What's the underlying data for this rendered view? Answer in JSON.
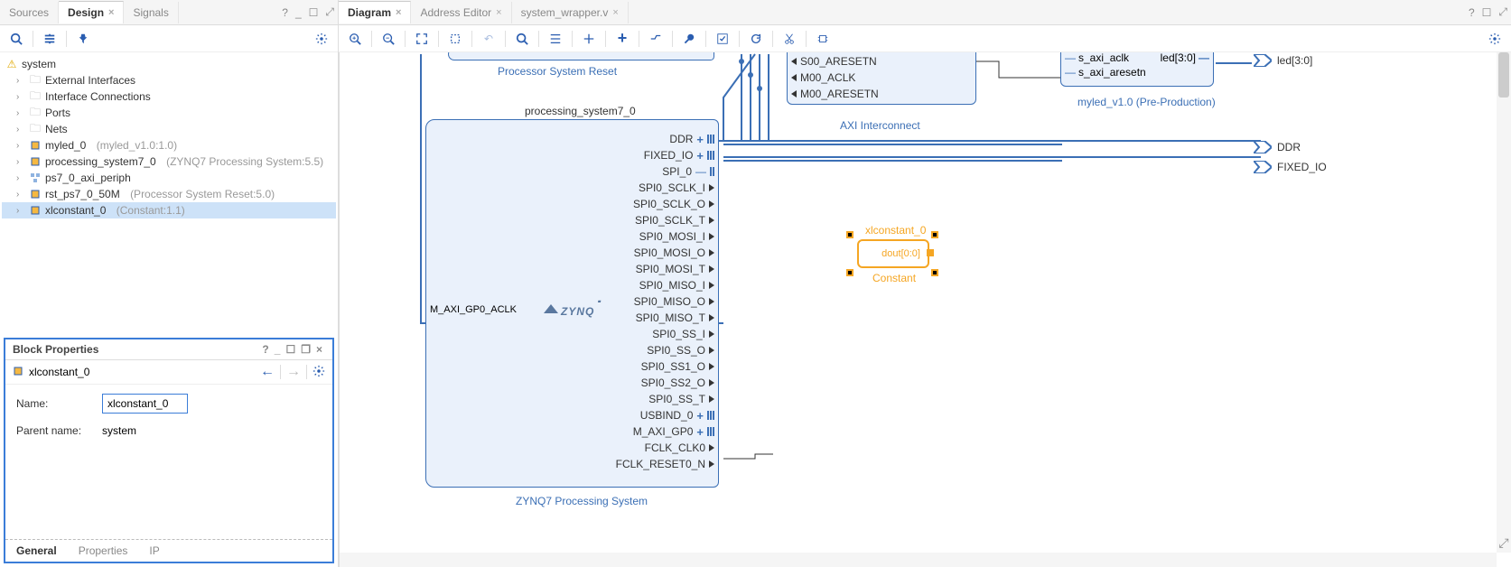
{
  "left_tabs": {
    "sources": "Sources",
    "design": "Design",
    "signals": "Signals"
  },
  "tree": {
    "root": "system",
    "items": [
      {
        "label": "External Interfaces",
        "type": "folder"
      },
      {
        "label": "Interface Connections",
        "type": "folder"
      },
      {
        "label": "Ports",
        "type": "folder"
      },
      {
        "label": "Nets",
        "type": "folder"
      },
      {
        "label": "myled_0",
        "dim": "(myled_v1.0:1.0)",
        "type": "ip"
      },
      {
        "label": "processing_system7_0",
        "dim": "(ZYNQ7 Processing System:5.5)",
        "type": "ip"
      },
      {
        "label": "ps7_0_axi_periph",
        "dim": "",
        "type": "hier"
      },
      {
        "label": "rst_ps7_0_50M",
        "dim": "(Processor System Reset:5.0)",
        "type": "ip"
      },
      {
        "label": "xlconstant_0",
        "dim": "(Constant:1.1)",
        "type": "ip",
        "sel": true
      }
    ]
  },
  "props": {
    "title": "Block Properties",
    "heading": "xlconstant_0",
    "name_label": "Name:",
    "name_value": "xlconstant_0",
    "parent_label": "Parent name:",
    "parent_value": "system",
    "tabs": {
      "general": "General",
      "properties": "Properties",
      "ip": "IP"
    }
  },
  "right_tabs": {
    "diagram": "Diagram",
    "address": "Address Editor",
    "wrapper": "system_wrapper.v"
  },
  "diagram": {
    "reset_label": "Processor System Reset",
    "ps7_name": "processing_system7_0",
    "ps7_footer": "ZYNQ7 Processing System",
    "ps7_left_port": "M_AXI_GP0_ACLK",
    "ps7_logo": "ZYNQ",
    "ps7_ports": [
      "DDR",
      "FIXED_IO",
      "SPI_0",
      "SPI0_SCLK_I",
      "SPI0_SCLK_O",
      "SPI0_SCLK_T",
      "SPI0_MOSI_I",
      "SPI0_MOSI_O",
      "SPI0_MOSI_T",
      "SPI0_MISO_I",
      "SPI0_MISO_O",
      "SPI0_MISO_T",
      "SPI0_SS_I",
      "SPI0_SS_O",
      "SPI0_SS1_O",
      "SPI0_SS2_O",
      "SPI0_SS_T",
      "USBIND_0",
      "M_AXI_GP0",
      "FCLK_CLK0",
      "FCLK_RESET0_N"
    ],
    "axi": {
      "ports": [
        "S00_ARESETN",
        "M00_ACLK",
        "M00_ARESETN"
      ],
      "footer": "AXI Interconnect"
    },
    "myled": {
      "ports_in": [
        "s_axi_aclk",
        "s_axi_aresetn"
      ],
      "port_out": "led[3:0]",
      "footer": "myled_v1.0 (Pre-Production)"
    },
    "const": {
      "name": "xlconstant_0",
      "port": "dout[0:0]",
      "footer": "Constant"
    },
    "out_ports": {
      "led": "led[3:0]",
      "ddr": "DDR",
      "fixed": "FIXED_IO"
    }
  }
}
